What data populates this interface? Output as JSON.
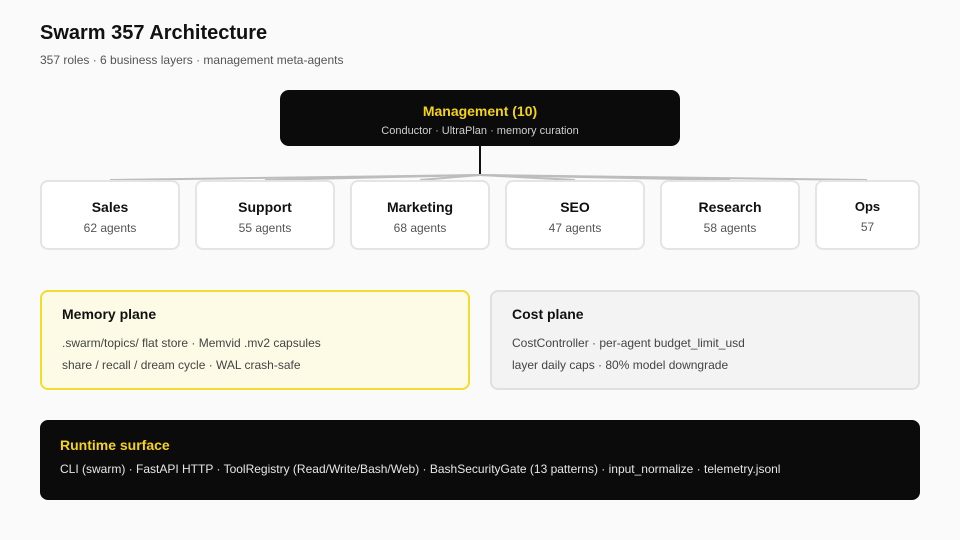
{
  "header": {
    "title": "Swarm 357 Architecture",
    "subtitle": "357 roles · 6 business layers · management meta-agents"
  },
  "management": {
    "title": "Management (10)",
    "subtitle": "Conductor · UltraPlan · memory curation"
  },
  "layers": [
    {
      "name": "Sales",
      "count": "62 agents"
    },
    {
      "name": "Support",
      "count": "55 agents"
    },
    {
      "name": "Marketing",
      "count": "68 agents"
    },
    {
      "name": "SEO",
      "count": "47 agents"
    },
    {
      "name": "Research",
      "count": "58 agents"
    },
    {
      "name": "Ops",
      "count": "57"
    }
  ],
  "planes": {
    "memory": {
      "title": "Memory plane",
      "lines": [
        ".swarm/topics/ flat store · Memvid .mv2 capsules",
        "share / recall / dream cycle · WAL crash-safe"
      ]
    },
    "cost": {
      "title": "Cost plane",
      "lines": [
        "CostController · per-agent budget_limit_usd",
        "layer daily caps · 80% model downgrade"
      ]
    }
  },
  "runtime": {
    "title": "Runtime surface",
    "line": "CLI (swarm) · FastAPI HTTP · ToolRegistry (Read/Write/Bash/Web) · BashSecurityGate (13 patterns) · input_normalize · telemetry.jsonl"
  },
  "colors": {
    "accent": "#f5d31a",
    "dark": "#0b0b0b",
    "connector": "#bdbdbd"
  }
}
